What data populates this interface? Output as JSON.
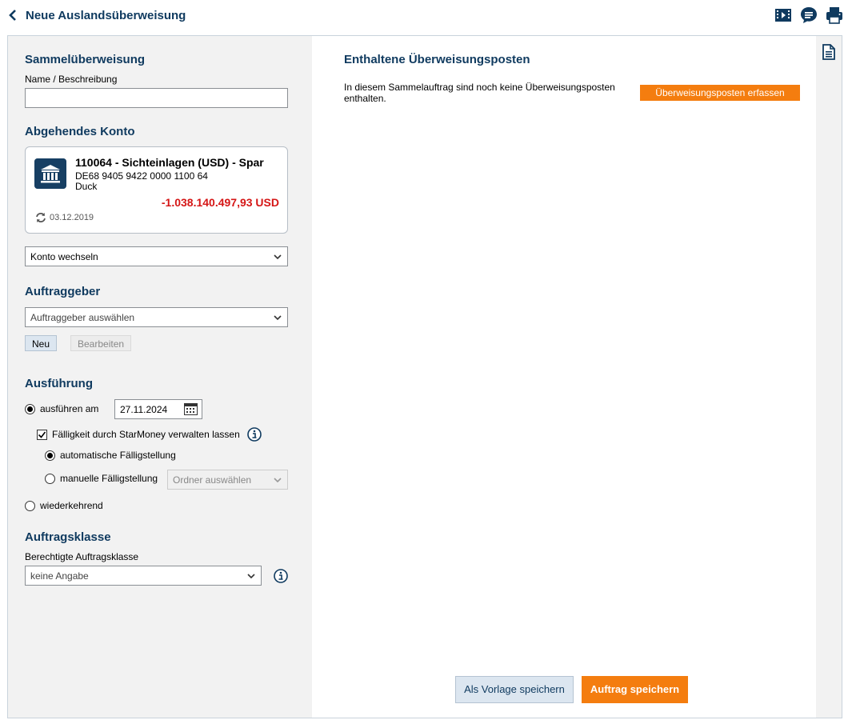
{
  "header": {
    "title": "Neue Auslandsüberweisung",
    "icons": [
      "back-chevron-icon",
      "video-icon",
      "chat-icon",
      "print-icon"
    ]
  },
  "sammel": {
    "heading": "Sammelüberweisung",
    "name_label": "Name / Beschreibung",
    "name_value": ""
  },
  "konto": {
    "heading": "Abgehendes Konto",
    "account_name": "110064 - Sichteinlagen (USD) - Spar",
    "iban": "DE68 9405 9422 0000 1100 64",
    "owner": "Duck",
    "balance": "-1.038.140.497,93 USD",
    "balance_color": "#d51616",
    "date": "03.12.2019",
    "switch_label": "Konto wechseln"
  },
  "auftraggeber": {
    "heading": "Auftraggeber",
    "select_placeholder": "Auftraggeber auswählen",
    "new_label": "Neu",
    "edit_label": "Bearbeiten"
  },
  "ausfuehrung": {
    "heading": "Ausführung",
    "opt_date_label": "ausführen am",
    "date_value": "27.11.2024",
    "check_label": "Fälligkeit durch StarMoney verwalten lassen",
    "auto_label": "automatische Fälligstellung",
    "manual_label": "manuelle Fälligstellung",
    "folder_placeholder": "Ordner auswählen",
    "recurring_label": "wiederkehrend"
  },
  "auftragsklasse": {
    "heading": "Auftragsklasse",
    "label": "Berechtigte Auftragsklasse",
    "value": "keine Angabe"
  },
  "main": {
    "heading": "Enthaltene Überweisungsposten",
    "message": "In diesem Sammelauftrag sind noch keine Überweisungsposten enthalten.",
    "add_button": "Überweisungsposten erfassen",
    "template_button": "Als Vorlage speichern",
    "save_button": "Auftrag speichern"
  },
  "colors": {
    "accent": "#f47d0f",
    "heading": "#0f3a5f",
    "panel": "#f2f2f2"
  }
}
